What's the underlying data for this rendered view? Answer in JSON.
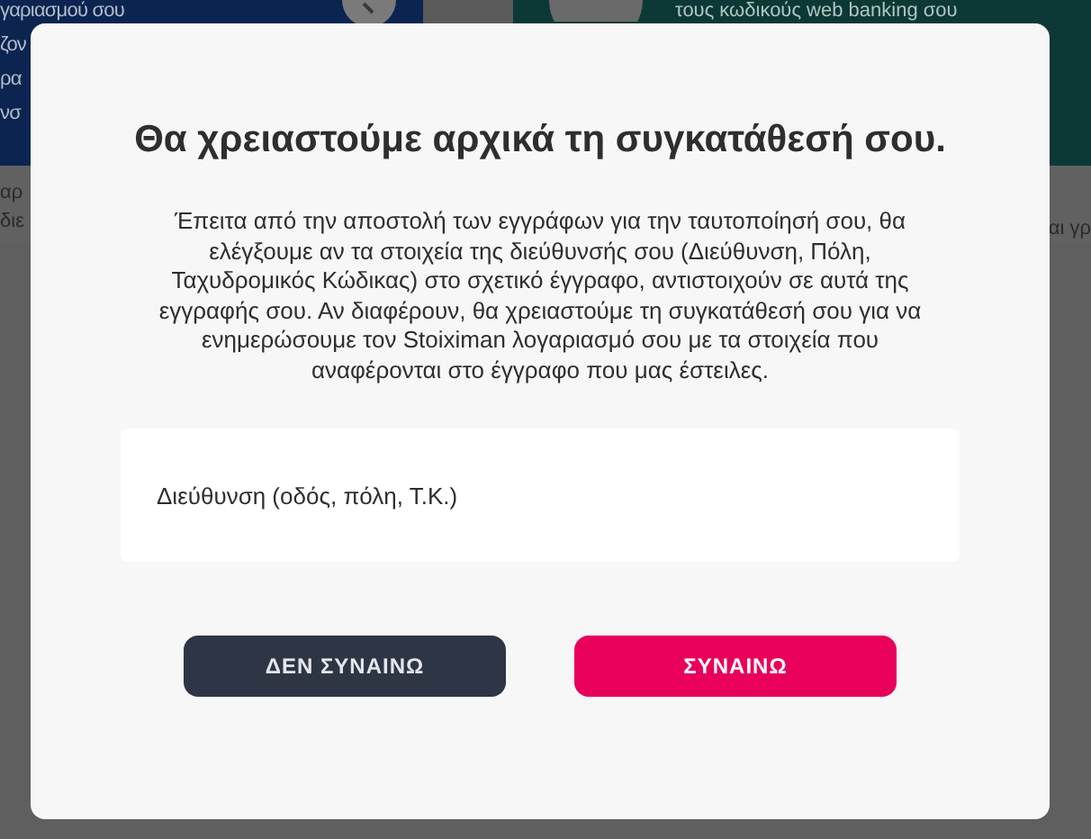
{
  "background": {
    "left_banner_lines": [
      "γαριασμού σου",
      "ζον",
      "ρα",
      "νσ"
    ],
    "right_banner_text": "τους κωδικούς web banking σου",
    "left_caption_lines": [
      "αρ",
      "διε"
    ],
    "right_caption": "αι γρ"
  },
  "dialog": {
    "title": "Θα χρειαστούμε αρχικά τη συγκατάθεσή σου.",
    "body": "Έπειτα από την αποστολή των εγγράφων για την ταυτοποίησή σου, θα ελέγξουμε αν τα στοιχεία της διεύθυνσής σου (Διεύθυνση, Πόλη, Ταχυδρομικός Κώδικας) στο σχετικό έγγραφο, αντιστοιχούν σε αυτά της εγγραφής σου. Αν διαφέρουν, θα χρειαστούμε τη συγκατάθεσή σου για να ενημερώσουμε τον Stoiximan λογαριασμό σου με τα στοιχεία που αναφέρονται στο έγγραφο που μας έστειλες.",
    "address_field": {
      "placeholder": "Διεύθυνση (οδός, πόλη, Τ.Κ.)"
    },
    "buttons": [
      {
        "label": "ΔΕΝ ΣΥΝΑΙΝΩ",
        "kind": "secondary"
      },
      {
        "label": "ΣΥΝΑΙΝΩ",
        "kind": "primary"
      }
    ]
  }
}
